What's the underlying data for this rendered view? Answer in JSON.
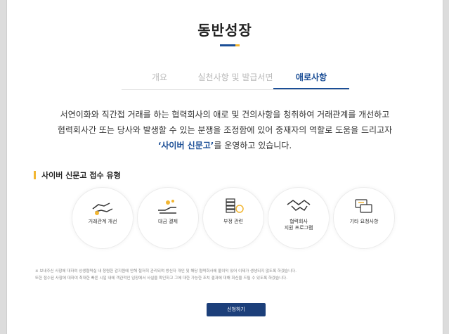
{
  "page": {
    "title": "동반성장"
  },
  "tabs": [
    {
      "label": "개요",
      "active": false
    },
    {
      "label": "실천사항 및 발급서면",
      "active": false
    },
    {
      "label": "애로사항",
      "active": true
    }
  ],
  "intro": {
    "line1": "서연이화와 직간접 거래를 하는 협력회사의 애로 및 건의사항을 청취하여 거래관계를 개선하고",
    "line2": "협력회사간 또는 당사와 발생할 수 있는 분쟁을 조정함에 있어 중재자의 역할로 도움을 드리고자",
    "emphasis": "‘사이버 신문고’",
    "line3_tail": "를 운영하고 있습니다."
  },
  "section": {
    "title": "사이버 신문고 접수 유형"
  },
  "categories": [
    {
      "label": "거래관계 개선",
      "icon": "handshake-hand-icon"
    },
    {
      "label": "대금 결제",
      "icon": "money-hand-icon"
    },
    {
      "label": "부정 관련",
      "icon": "coin-stack-icon"
    },
    {
      "label": "협력회사 지원 프로그램",
      "label_line1": "협력회사",
      "label_line2": "지원 프로그램",
      "icon": "handshake-icon"
    },
    {
      "label": "기타 요청사항",
      "icon": "chat-bubbles-icon"
    }
  ],
  "notes": {
    "line1": "※ 보내주신 사항에 대하여 상생협력실 내 청렴한 감지원에 안해 철저히 관리되며 방신자 개인 및 해당 협력회사에 불이익 있어 이제가 생생되지 않도록 하겠습니다.",
    "line2": "또한 접수된 사항에 대하여 최대한 빠른 시일 내에 객관적인 입장에서 사실을 확인하고 그에 대한 가능한 조치 결과에 대해 회신을 드릴 수 있도록 하겠습니다."
  },
  "button": {
    "label": "신청하기"
  },
  "colors": {
    "accent": "#1b4e96",
    "highlight": "#f2b632",
    "button": "#1c3f7a"
  }
}
